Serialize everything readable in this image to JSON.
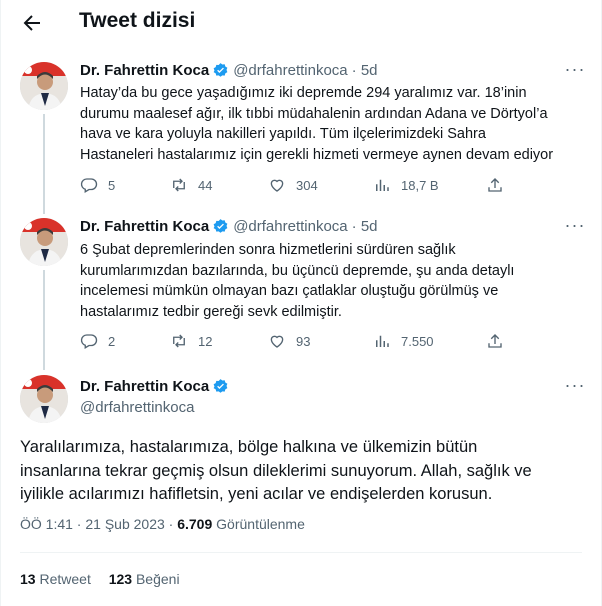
{
  "header": {
    "title": "Tweet dizisi",
    "back_icon": "arrow-left-icon"
  },
  "tweets": [
    {
      "name": "Dr. Fahrettin Koca",
      "handle": "@drfahrettinkoca",
      "time": "· 5d",
      "text": "Hatay’da bu gece yaşadığımız iki depremde 294 yaralımız var. 18’inin\ndurumu maalesef ağır, ilk tıbbi müdahalenin ardından Adana ve Dörtyol’a\nhava ve kara yoluyla nakilleri yapıldı. Tüm ilçelerimizdeki Sahra\nHastaneleri hastalarımız için gerekli hizmeti vermeye aynen devam ediyor",
      "replies": "5",
      "retweets": "44",
      "likes": "304",
      "views": "18,7 B"
    },
    {
      "name": "Dr. Fahrettin Koca",
      "handle": "@drfahrettinkoca",
      "time": "· 5d",
      "text": "6 Şubat depremlerinden sonra hizmetlerini sürdüren sağlık\nkurumlarımızdan bazılarında, bu üçüncü depremde, şu anda detaylı\nincelemesi mümkün olmayan bazı çatlaklar oluştuğu görülmüş ve\nhastalarımız tedbir gereği sevk edilmiştir.",
      "replies": "2",
      "retweets": "12",
      "likes": "93",
      "views": "7.550"
    }
  ],
  "main_tweet": {
    "name": "Dr. Fahrettin Koca",
    "handle": "@drfahrettinkoca",
    "text": "Yaralılarımıza, hastalarımıza, bölge halkına ve ülkemizin bütün\ninsanlarına tekrar geçmiş olsun dileklerimi sunuyorum. Allah, sağlık ve\niyilikle acılarımızı hafifletsin, yeni acılar ve endişelerden korusun.",
    "time": "ÖÖ 1:41 · 21 Şub 2023 ·",
    "views_count": "6.709",
    "views_label": "Görüntülenme",
    "retweet_count": "13",
    "retweet_label": "Retweet",
    "like_count": "123",
    "like_label": "Beğeni"
  },
  "colors": {
    "text": "#0f1419",
    "secondary": "#536471",
    "verified": "#1d9bf0",
    "divider": "#eff3f4"
  }
}
